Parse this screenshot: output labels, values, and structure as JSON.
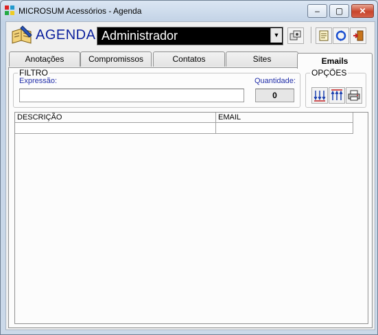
{
  "window": {
    "title": "MICROSUM Acessórios - Agenda",
    "controls": {
      "minimize": "–",
      "maximize": "▢",
      "close": "✕"
    }
  },
  "header": {
    "app_name": "AGENDA",
    "user_selected": "Administrador",
    "icons": [
      "lookup-icon",
      "notes-icon",
      "refresh-icon",
      "exit-door-icon"
    ]
  },
  "tabs": [
    {
      "label": "Anotações",
      "active": false
    },
    {
      "label": "Compromissos",
      "active": false
    },
    {
      "label": "Contatos",
      "active": false
    },
    {
      "label": "Sites",
      "active": false
    },
    {
      "label": "Emails",
      "active": true
    }
  ],
  "filter": {
    "legend": "FILTRO",
    "expression_label": "Expressão:",
    "expression_value": "",
    "quantity_label": "Quantidade:",
    "quantity_value": "0"
  },
  "options": {
    "legend": "OPÇÕES",
    "buttons": [
      "sort-desc-icon",
      "sort-asc-icon",
      "print-icon"
    ]
  },
  "grid": {
    "columns": [
      "DESCRIÇÃO",
      "EMAIL"
    ],
    "rows": [
      [
        "",
        ""
      ]
    ]
  }
}
